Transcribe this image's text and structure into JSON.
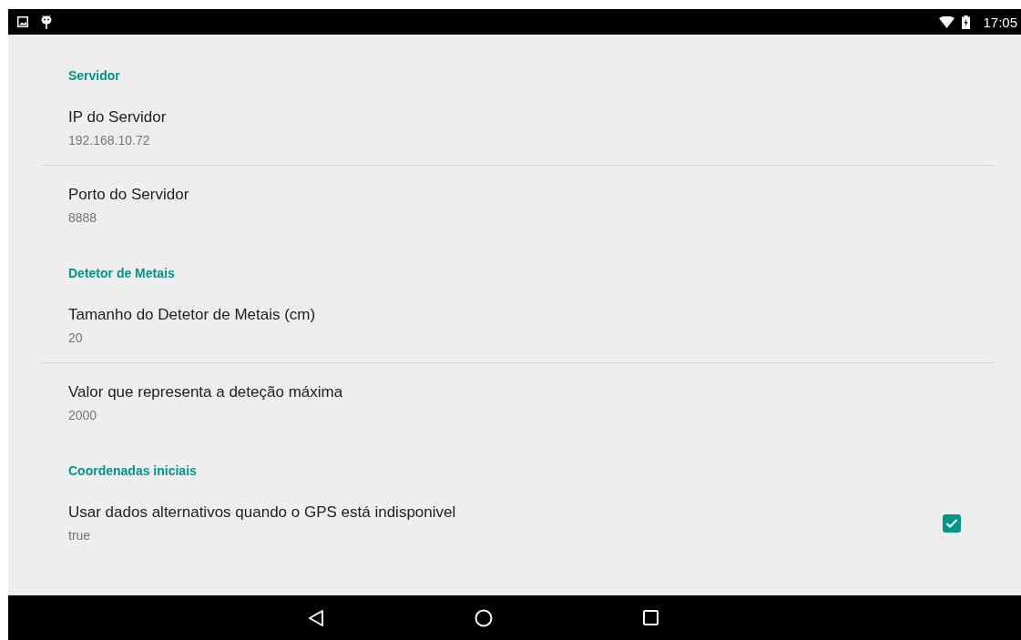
{
  "status_bar": {
    "time": "17:05"
  },
  "categories": [
    {
      "title": "Servidor",
      "items": [
        {
          "kind": "text",
          "title": "IP do Servidor",
          "summary": "192.168.10.72"
        },
        {
          "kind": "text",
          "title": "Porto do Servidor",
          "summary": "8888"
        }
      ]
    },
    {
      "title": "Detetor de Metais",
      "items": [
        {
          "kind": "text",
          "title": "Tamanho do Detetor de Metais (cm)",
          "summary": "20"
        },
        {
          "kind": "text",
          "title": "Valor que representa a deteção máxima",
          "summary": "2000"
        }
      ]
    },
    {
      "title": "Coordenadas iniciais",
      "items": [
        {
          "kind": "checkbox",
          "title": "Usar dados alternativos quando o GPS está indisponivel",
          "summary": "true",
          "checked": true
        }
      ]
    }
  ]
}
